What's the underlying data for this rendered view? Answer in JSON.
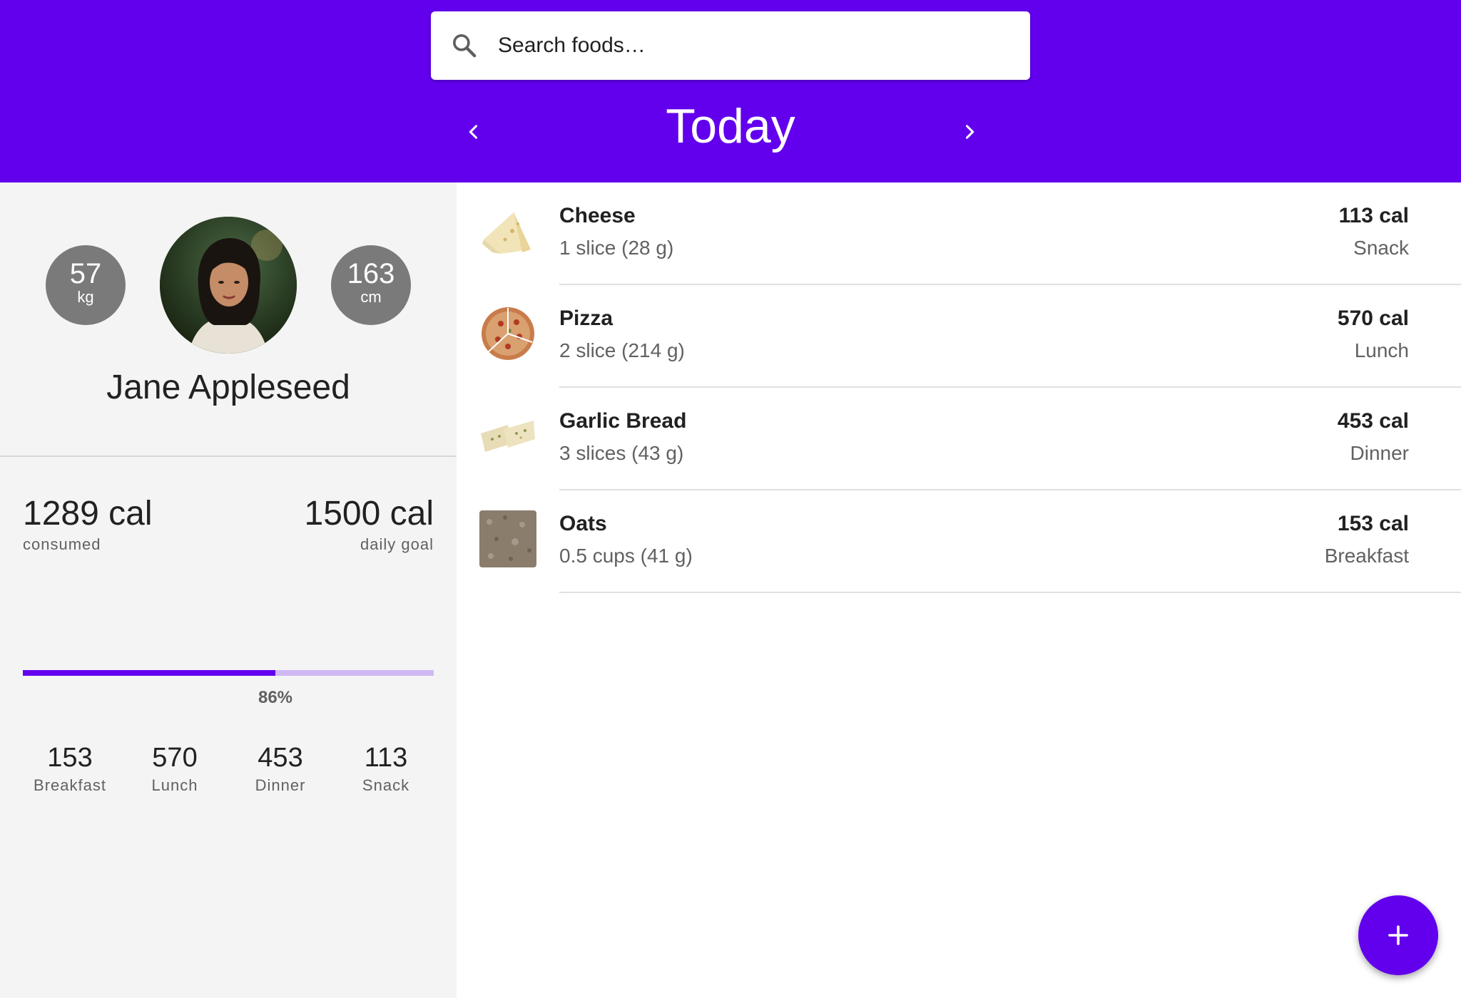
{
  "header": {
    "search": {
      "placeholder": "Search foods…",
      "icon": "search-icon"
    },
    "date_title": "Today",
    "prev_icon": "chevron-left-icon",
    "next_icon": "chevron-right-icon",
    "accent": "#6200ee"
  },
  "profile": {
    "weight": {
      "value": "57",
      "unit": "kg"
    },
    "height": {
      "value": "163",
      "unit": "cm"
    },
    "name": "Jane Appleseed"
  },
  "summary": {
    "consumed": {
      "value": "1289 cal",
      "caption": "consumed"
    },
    "goal": {
      "value": "1500 cal",
      "caption": "daily goal"
    },
    "progress_fraction": 0.86,
    "percent_label": "86%",
    "meals": [
      {
        "value": "153",
        "label": "Breakfast"
      },
      {
        "value": "570",
        "label": "Lunch"
      },
      {
        "value": "453",
        "label": "Dinner"
      },
      {
        "value": "113",
        "label": "Snack"
      }
    ]
  },
  "foods": [
    {
      "name": "Cheese",
      "portion": "1 slice (28 g)",
      "calories": "113 cal",
      "meal": "Snack",
      "icon": "cheese-thumbnail"
    },
    {
      "name": "Pizza",
      "portion": "2 slice (214 g)",
      "calories": "570 cal",
      "meal": "Lunch",
      "icon": "pizza-thumbnail"
    },
    {
      "name": "Garlic Bread",
      "portion": "3 slices (43 g)",
      "calories": "453 cal",
      "meal": "Dinner",
      "icon": "garlic-bread-thumbnail"
    },
    {
      "name": "Oats",
      "portion": "0.5 cups (41 g)",
      "calories": "153 cal",
      "meal": "Breakfast",
      "icon": "oats-thumbnail"
    }
  ],
  "fab": {
    "icon": "plus-icon"
  }
}
